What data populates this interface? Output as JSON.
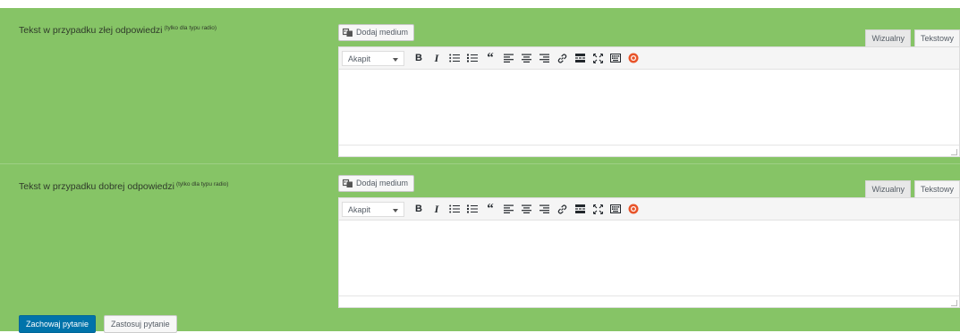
{
  "fields": [
    {
      "label": "Tekst w przypadku złej odpowiedzi",
      "note": "(tylko dla typu radio)",
      "media_button": "Dodaj medium",
      "tabs": [
        "Wizualny",
        "Tekstowy"
      ],
      "format_select": "Akapit"
    },
    {
      "label": "Tekst w przypadku dobrej odpowiedzi",
      "note": "(tylko dla typu radio)",
      "media_button": "Dodaj medium",
      "tabs": [
        "Wizualny",
        "Tekstowy"
      ],
      "format_select": "Akapit"
    }
  ],
  "footer": {
    "save_label": "Zachowaj pytanie",
    "apply_label": "Zastosuj pytanie"
  },
  "colors": {
    "panel_bg": "#86c466",
    "primary": "#0073aa"
  },
  "toolbar_icons": [
    "bold-icon",
    "italic-icon",
    "bullet-list-icon",
    "numbered-list-icon",
    "blockquote-icon",
    "align-left-icon",
    "align-center-icon",
    "align-right-icon",
    "link-icon",
    "read-more-icon",
    "fullscreen-icon",
    "toolbar-toggle-icon",
    "plugin-icon"
  ]
}
